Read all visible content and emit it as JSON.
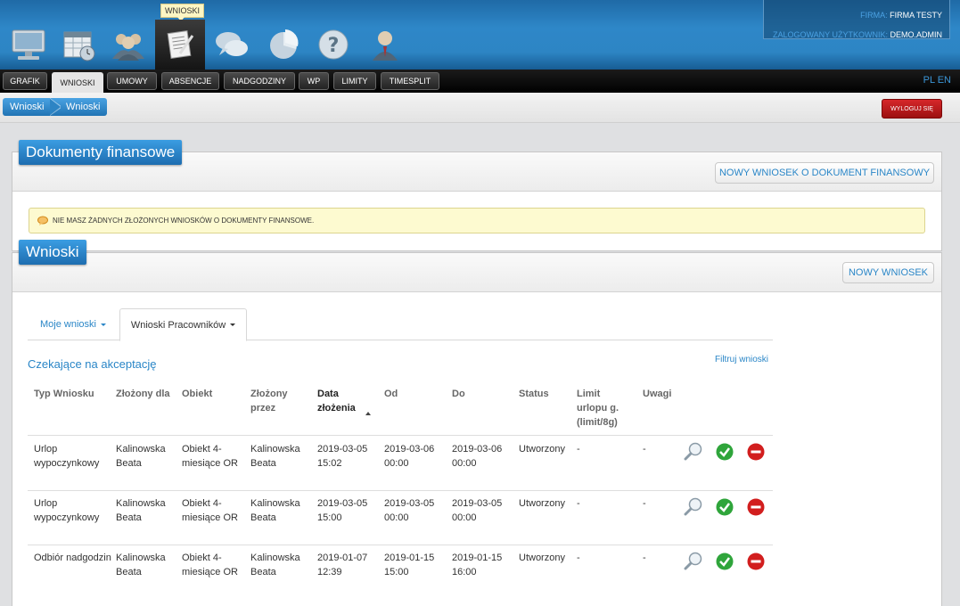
{
  "header": {
    "tooltip": "WNIOSKI",
    "modules": [
      {
        "name": "computer-icon"
      },
      {
        "name": "calendar-icon"
      },
      {
        "name": "users-icon"
      },
      {
        "name": "document-pen-icon",
        "active": true
      },
      {
        "name": "chat-icon"
      },
      {
        "name": "pie-chart-icon"
      },
      {
        "name": "help-icon"
      },
      {
        "name": "user-icon"
      }
    ],
    "firma_label": "FIRMA:",
    "firma_value": "FIRMA TESTY",
    "user_label": "ZALOGOWANY UŻYTKOWNIK:",
    "user_value": "DEMO.ADMIN"
  },
  "tabs": [
    "GRAFIK",
    "WNIOSKI",
    "UMOWY",
    "ABSENCJE",
    "NADGODZINY",
    "WP",
    "LIMITY",
    "TIMESPLIT"
  ],
  "active_tab": "WNIOSKI",
  "lang": "PL EN",
  "breadcrumb": [
    "Wnioski",
    "Wnioski"
  ],
  "logout_label": "WYLOGUJ SIĘ",
  "finance_panel": {
    "title": "Dokumenty finansowe",
    "new_button": "NOWY WNIOSEK O DOKUMENT FINANSOWY",
    "alert": "NIE MASZ ŻADNYCH ZŁOŻONYCH WNIOSKÓW O DOKUMENTY FINANSOWE."
  },
  "requests_panel": {
    "title": "Wnioski",
    "new_button": "NOWY WNIOSEK",
    "subtabs": [
      "Moje wnioski",
      "Wnioski Pracowników"
    ],
    "section_title": "Czekające na akceptację",
    "filter_link": "Filtruj wnioski",
    "columns": [
      "Typ Wniosku",
      "Złożony dla",
      "Obiekt",
      "Złożony przez",
      "Data złożenia",
      "Od",
      "Do",
      "Status",
      "Limit urlopu g. (limit/8g)",
      "Uwagi"
    ],
    "rows": [
      {
        "typ": "Urlop wypoczynkowy",
        "dla": "Kalinowska Beata",
        "obiekt": "Obiekt 4-miesiące OR",
        "przez": "Kalinowska Beata",
        "data": "2019-03-05 15:02",
        "od": "2019-03-06 00:00",
        "do": "2019-03-06 00:00",
        "status": "Utworzony",
        "limit": "-",
        "uwagi": "-"
      },
      {
        "typ": "Urlop wypoczynkowy",
        "dla": "Kalinowska Beata",
        "obiekt": "Obiekt 4-miesiące OR",
        "przez": "Kalinowska Beata",
        "data": "2019-03-05 15:00",
        "od": "2019-03-05 00:00",
        "do": "2019-03-05 00:00",
        "status": "Utworzony",
        "limit": "-",
        "uwagi": "-"
      },
      {
        "typ": "Odbiór nadgodzin",
        "dla": "Kalinowska Beata",
        "obiekt": "Obiekt 4-miesiące OR",
        "przez": "Kalinowska Beata",
        "data": "2019-01-07 12:39",
        "od": "2019-01-15 15:00",
        "do": "2019-01-15 16:00",
        "status": "Utworzony",
        "limit": "-",
        "uwagi": "-"
      }
    ]
  }
}
